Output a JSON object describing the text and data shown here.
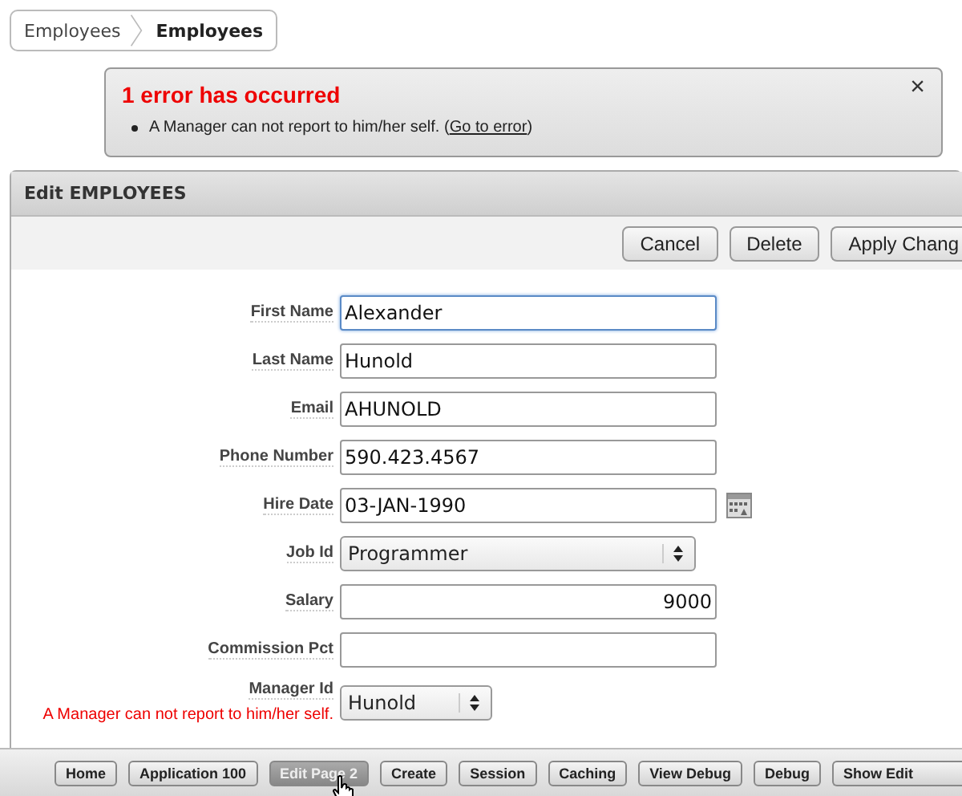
{
  "breadcrumb": [
    {
      "label": "Employees",
      "current": false
    },
    {
      "label": "Employees",
      "current": true
    }
  ],
  "notification": {
    "title": "1 error has occurred",
    "message": "A Manager can not report to him/her self. (",
    "link": "Go to error",
    "message_end": ")",
    "close": "×"
  },
  "region": {
    "title": "Edit EMPLOYEES",
    "buttons": [
      "Cancel",
      "Delete",
      "Apply Chang"
    ],
    "fields": [
      {
        "label": "First Name",
        "kind": "text",
        "value": "Alexander",
        "focused": true
      },
      {
        "label": "Last Name",
        "kind": "text",
        "value": "Hunold",
        "focused": false
      },
      {
        "label": "Email",
        "kind": "text",
        "value": "AHUNOLD",
        "focused": false
      },
      {
        "label": "Phone Number",
        "kind": "text",
        "value": "590.423.4567",
        "focused": false
      },
      {
        "label": "Hire Date",
        "kind": "date",
        "value": "03-JAN-1990",
        "focused": false
      },
      {
        "label": "Job Id",
        "kind": "select",
        "value": "Programmer"
      },
      {
        "label": "Salary",
        "kind": "number",
        "value": "9000",
        "focused": false
      },
      {
        "label": "Commission Pct",
        "kind": "number",
        "focused": false
      },
      {
        "label": "Manager Id",
        "kind": "smallselect",
        "value": "Hunold",
        "error": "A Manager can not report to him/her self."
      }
    ]
  },
  "dev_toolbar": [
    {
      "label": "Home",
      "hovered": false
    },
    {
      "label": "Application 100",
      "hovered": false
    },
    {
      "label": "Edit Page 2",
      "hovered": true
    },
    {
      "label": "Create",
      "hovered": false
    },
    {
      "label": "Session",
      "hovered": false
    },
    {
      "label": "Caching",
      "hovered": false
    },
    {
      "label": "View Debug",
      "hovered": false
    },
    {
      "label": "Debug",
      "hovered": false
    },
    {
      "label": "Show Edit",
      "hovered": false
    }
  ]
}
